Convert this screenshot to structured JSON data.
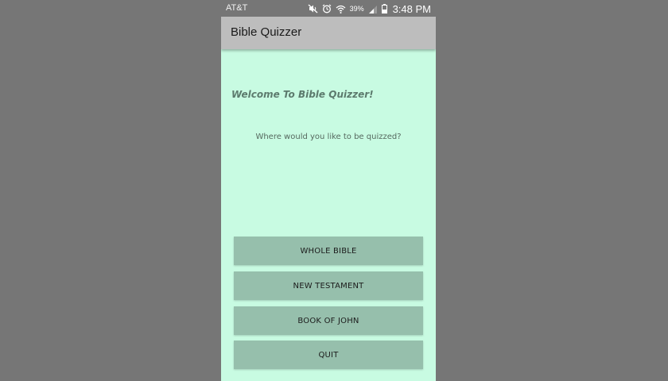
{
  "status_bar": {
    "carrier": "AT&T",
    "battery_percent": "39%",
    "time": "3:48 PM",
    "icons": [
      "mute-icon",
      "alarm-icon",
      "wifi-icon",
      "signal-icon",
      "battery-icon"
    ]
  },
  "app_bar": {
    "title": "Bible Quizzer"
  },
  "main": {
    "welcome": "Welcome To Bible Quizzer!",
    "prompt": "Where would you like to be quizzed?",
    "buttons": [
      {
        "label": "WHOLE BIBLE"
      },
      {
        "label": "NEW TESTAMENT"
      },
      {
        "label": "BOOK OF JOHN"
      },
      {
        "label": "QUIT"
      }
    ]
  },
  "colors": {
    "page_background": "#767676",
    "app_background": "#c8fbe2",
    "app_bar": "#bdbdbd",
    "button": "#96bfac",
    "welcome_text": "#5c7a6d"
  }
}
